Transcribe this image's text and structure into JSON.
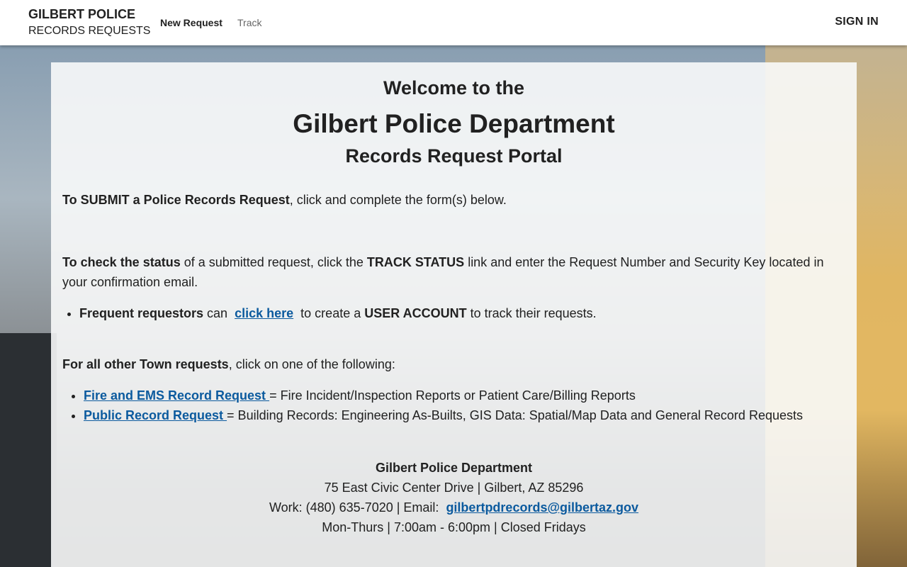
{
  "header": {
    "brand_line1": "GILBERT POLICE",
    "brand_line2": "RECORDS REQUESTS",
    "nav": [
      "New Request",
      "Track"
    ],
    "sign_in": "SIGN IN"
  },
  "main": {
    "welcome": "Welcome to the",
    "title": "Gilbert Police Department",
    "subtitle": "Records Request Portal",
    "submit_bold": "To SUBMIT a Police Records Request",
    "submit_rest": ", click and complete the form(s) below.",
    "status_bold": "To check the status",
    "status_mid": " of a submitted request, click the ",
    "status_bold2": "TRACK STATUS",
    "status_rest": " link and enter the Request Number and Security Key located in your confirmation email.",
    "freq_bold": "Frequent requestors",
    "freq_can": " can ",
    "freq_link": "click here",
    "freq_mid": " to create a ",
    "freq_bold2": "USER ACCOUNT",
    "freq_rest": " to track their requests.",
    "other_bold": "For all other Town requests",
    "other_rest": ", click on one of the following:",
    "links": [
      {
        "label": "Fire and EMS Record Request ",
        "desc": " = Fire Incident/Inspection Reports or Patient Care/Billing Reports"
      },
      {
        "label": "Public Record Request ",
        "desc": " = Building Records: Engineering As-Builts, GIS Data: Spatial/Map Data and General Record Requests"
      }
    ],
    "contact": {
      "name": "Gilbert Police Department",
      "address": "75 East Civic Center Drive | Gilbert, AZ 85296",
      "work": "Work: (480) 635-7020 | Email: ",
      "email": "gilbertpdrecords@gilbertaz.gov",
      "hours": "Mon-Thurs | 7:00am - 6:00pm | Closed Fridays"
    }
  },
  "colors": {
    "link": "#0b5a9e",
    "header_bg": "#ffffff"
  }
}
